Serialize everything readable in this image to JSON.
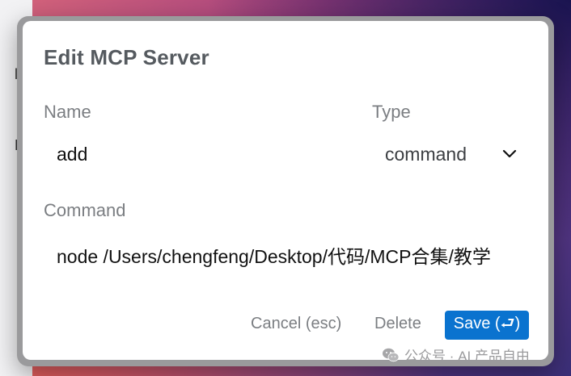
{
  "background_window": {
    "fragments": [
      "la",
      "De"
    ]
  },
  "dialog": {
    "title": "Edit MCP Server",
    "name_label": "Name",
    "name_value": "add",
    "type_label": "Type",
    "type_value": "command",
    "command_label": "Command",
    "command_value": "node /Users/chengfeng/Desktop/代码/MCP合集/教学",
    "cancel_label": "Cancel (esc)",
    "delete_label": "Delete",
    "save_label": "Save (⮐)"
  },
  "watermark": {
    "text": "公众号 · AI 产品自由",
    "icon": "wechat-icon"
  },
  "colors": {
    "save_button": "#0a73cf",
    "label_gray": "#7b7e82"
  }
}
